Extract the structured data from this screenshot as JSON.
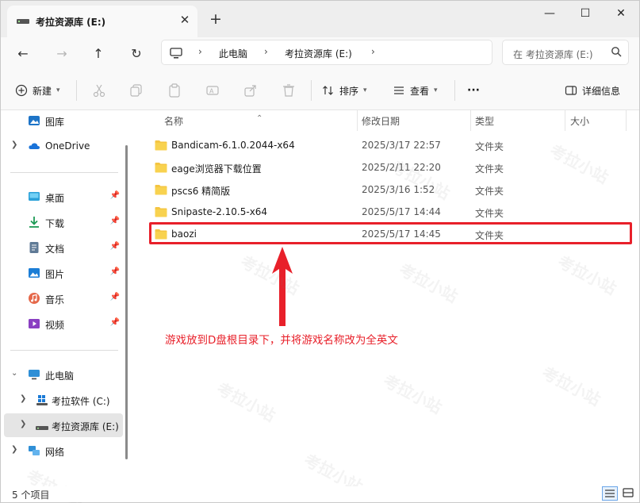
{
  "tab": {
    "title": "考拉资源库 (E:)",
    "close": "✕",
    "new_tab": "+"
  },
  "window_controls": {
    "minimize": "—",
    "maximize": "☐",
    "close": "✕"
  },
  "nav": {
    "back": "←",
    "forward": "→",
    "up": "↑",
    "refresh": "↻"
  },
  "address": {
    "crumbs": [
      "此电脑",
      "考拉资源库 (E:)"
    ],
    "sep": "›"
  },
  "search": {
    "placeholder": "在 考拉资源库 (E:)"
  },
  "command_bar": {
    "new_label": "新建",
    "sort_label": "排序",
    "view_label": "查看",
    "more_label": "···",
    "details_label": "详细信息"
  },
  "sidebar": {
    "items": [
      {
        "label": "图库",
        "icon": "gallery-icon",
        "expandable": false
      },
      {
        "label": "OneDrive",
        "icon": "cloud-icon",
        "expandable": true
      },
      {
        "label": "桌面",
        "icon": "desktop-icon",
        "pinned": true
      },
      {
        "label": "下载",
        "icon": "download-icon",
        "pinned": true
      },
      {
        "label": "文档",
        "icon": "document-icon",
        "pinned": true
      },
      {
        "label": "图片",
        "icon": "picture-icon",
        "pinned": true
      },
      {
        "label": "音乐",
        "icon": "music-icon",
        "pinned": true
      },
      {
        "label": "视频",
        "icon": "video-icon",
        "pinned": true
      },
      {
        "label": "此电脑",
        "icon": "computer-icon",
        "expanded": true
      },
      {
        "label": "考拉软件 (C:)",
        "icon": "windows-drive-icon"
      },
      {
        "label": "考拉资源库 (E:)",
        "icon": "drive-icon",
        "selected": true
      },
      {
        "label": "网络",
        "icon": "network-icon"
      }
    ]
  },
  "columns": {
    "name": "名称",
    "date": "修改日期",
    "type": "类型",
    "size": "大小"
  },
  "files": [
    {
      "name": "Bandicam-6.1.0.2044-x64",
      "date": "2025/3/17 22:57",
      "type": "文件夹"
    },
    {
      "name": "eage浏览器下载位置",
      "date": "2025/2/11 22:20",
      "type": "文件夹"
    },
    {
      "name": "pscs6 精简版",
      "date": "2025/3/16 1:52",
      "type": "文件夹"
    },
    {
      "name": "Snipaste-2.10.5-x64",
      "date": "2025/5/17 14:44",
      "type": "文件夹"
    },
    {
      "name": "baozi",
      "date": "2025/5/17 14:45",
      "type": "文件夹"
    }
  ],
  "annotation": {
    "text": "游戏放到D盘根目录下，并将游戏名称改为全英文",
    "color": "#e8202a"
  },
  "status": {
    "item_count": "5 个项目"
  },
  "watermark": {
    "text": "考拉小站"
  },
  "colors": {
    "accent": "#e8202a",
    "folder": "#f4c542",
    "selection": "#e5e5e5"
  }
}
